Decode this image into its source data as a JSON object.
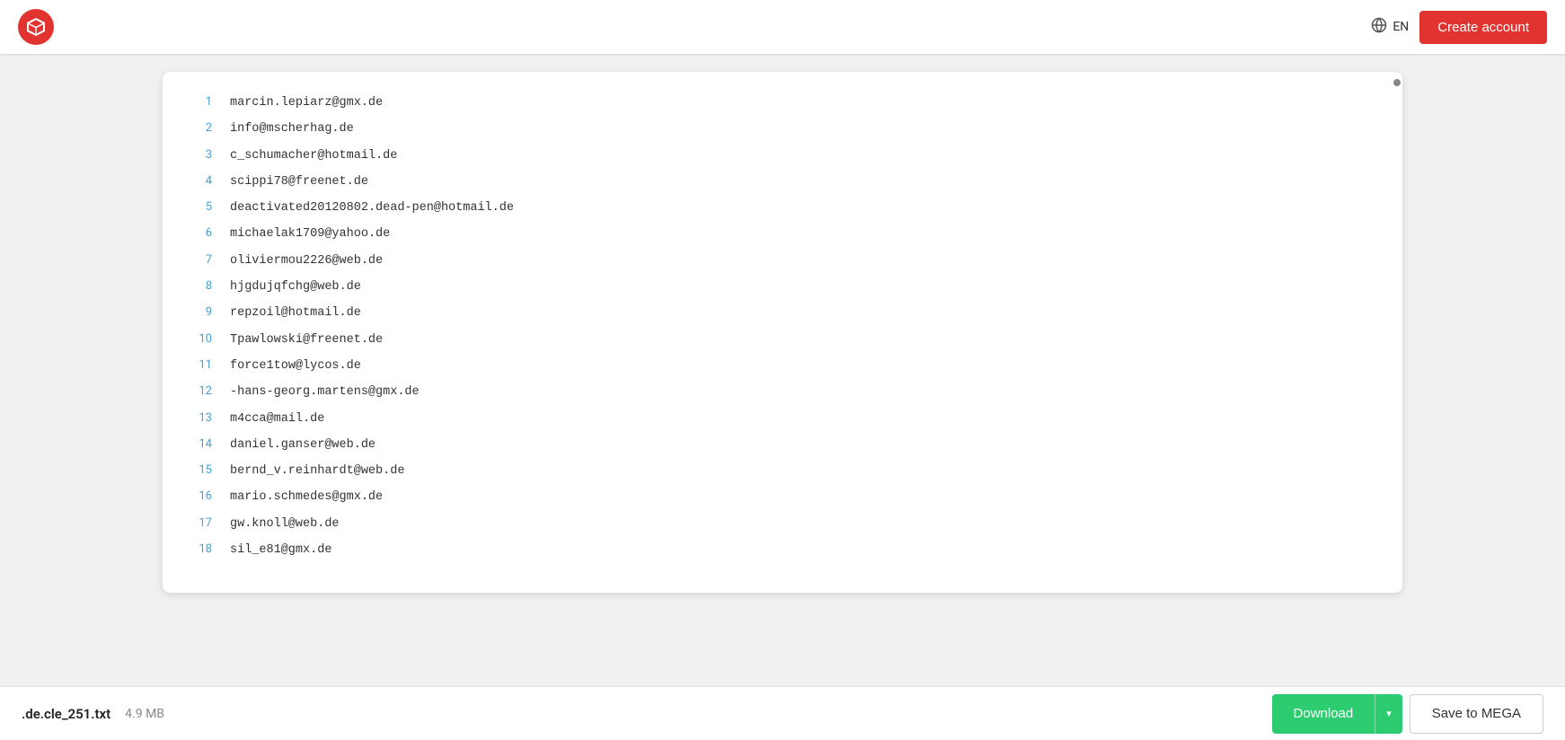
{
  "header": {
    "logo_alt": "MEGA logo",
    "language": "EN",
    "create_account_label": "Create account"
  },
  "file_viewer": {
    "lines": [
      {
        "number": "1",
        "content": "marcin.lepiarz@gmx.de"
      },
      {
        "number": "2",
        "content": "info@mscherhag.de"
      },
      {
        "number": "3",
        "content": "c_schumacher@hotmail.de"
      },
      {
        "number": "4",
        "content": "scippi78@freenet.de"
      },
      {
        "number": "5",
        "content": "deactivated20120802.dead-pen@hotmail.de"
      },
      {
        "number": "6",
        "content": "michaelak1709@yahoo.de"
      },
      {
        "number": "7",
        "content": "oliviermou2226@web.de"
      },
      {
        "number": "8",
        "content": "hjgdujqfchg@web.de"
      },
      {
        "number": "9",
        "content": "repzoil@hotmail.de"
      },
      {
        "number": "10",
        "content": "Tpawlowski@freenet.de"
      },
      {
        "number": "11",
        "content": "force1tow@lycos.de"
      },
      {
        "number": "12",
        "content": "-hans-georg.martens@gmx.de"
      },
      {
        "number": "13",
        "content": "m4cca@mail.de"
      },
      {
        "number": "14",
        "content": "daniel.ganser@web.de"
      },
      {
        "number": "15",
        "content": "bernd_v.reinhardt@web.de"
      },
      {
        "number": "16",
        "content": "mario.schmedes@gmx.de"
      },
      {
        "number": "17",
        "content": "gw.knoll@web.de"
      },
      {
        "number": "18",
        "content": "sil_e81@gmx.de"
      }
    ]
  },
  "footer": {
    "file_name": ".de.cle_251.txt",
    "file_size": "4.9 MB",
    "download_label": "Download",
    "save_to_mega_label": "Save to MEGA"
  }
}
